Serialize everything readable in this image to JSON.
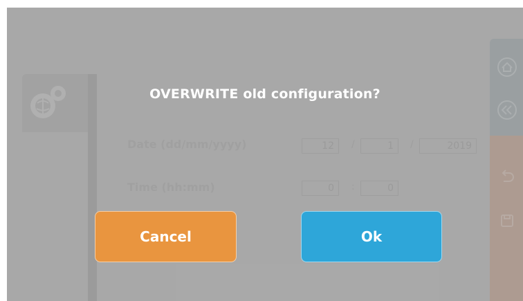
{
  "dialog": {
    "title": "OVERWRITE old configuration?",
    "cancel_label": "Cancel",
    "ok_label": "Ok"
  },
  "form": {
    "date_label": "Date (dd/mm/yyyy)",
    "time_label": "Time (hh:mm)",
    "date_day": "12",
    "date_month": "1",
    "date_year": "2019",
    "date_sep": "/",
    "time_hour": "0",
    "time_minute": "0",
    "time_sep": ":"
  },
  "icons": {
    "left_tab": "gears-globe-icon",
    "right_top": [
      "home-icon",
      "rewind-icon"
    ],
    "right_bottom": [
      "undo-icon",
      "save-icon"
    ]
  },
  "colors": {
    "cancel": "#e9953f",
    "ok": "#2ea6d9"
  }
}
